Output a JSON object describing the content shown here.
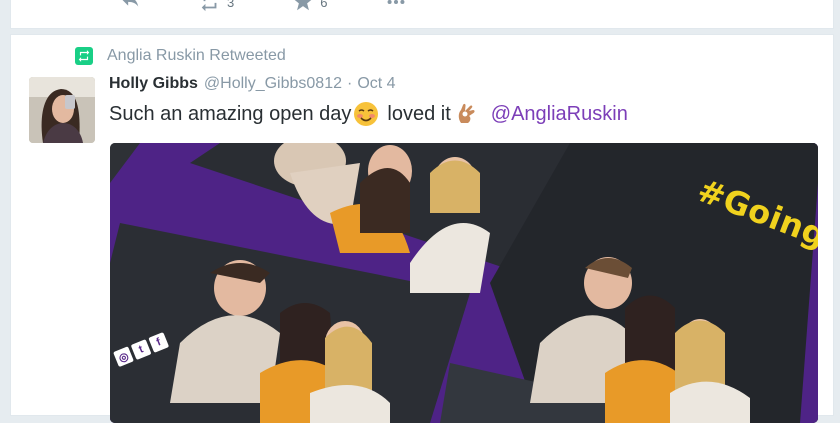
{
  "previous_tweet": {
    "actions": [
      {
        "icon": "reply-icon",
        "count": ""
      },
      {
        "icon": "retweet-icon",
        "count": "3"
      },
      {
        "icon": "like-icon",
        "count": "6"
      },
      {
        "icon": "more-icon",
        "count": ""
      }
    ]
  },
  "tweet": {
    "retweeted_by": "Anglia Ruskin Retweeted",
    "fullname": "Holly Gibbs",
    "username": "@Holly_Gibbs0812",
    "separator": "·",
    "date": "Oct 4",
    "text_part1": "Such an amazing open day",
    "text_part2": "loved it",
    "mention": "@AngliaRuskin",
    "media": {
      "hashtag": "#GoingtoARU",
      "social_icons": [
        "instagram-icon",
        "twitter-icon",
        "facebook-icon"
      ]
    }
  },
  "colors": {
    "mention": "#7c3eb8",
    "retweet_green": "#19cf86",
    "frame_purple": "#5b2a94",
    "hashtag_yellow": "#f0d21e"
  }
}
